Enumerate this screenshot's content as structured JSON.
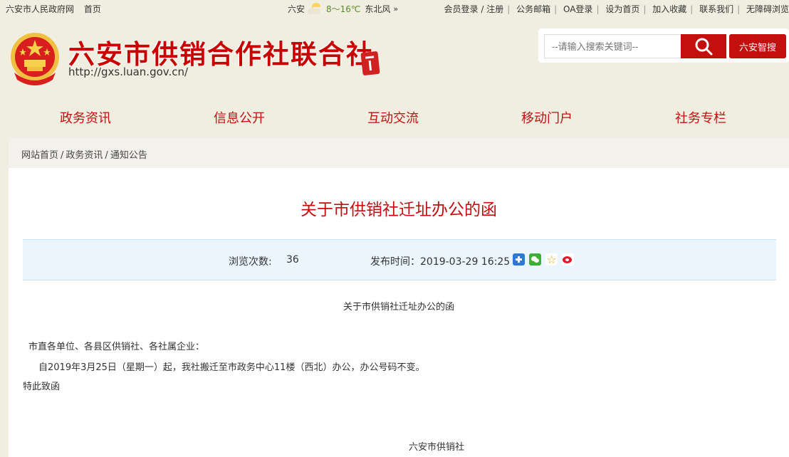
{
  "topbar": {
    "gov_link": "六安市人民政府网",
    "home_link": "首页",
    "city": "六安",
    "temp": "8～16℃",
    "wind": "东北风",
    "more": "»",
    "links": [
      "会员登录 / 注册",
      "公务邮箱",
      "OA登录",
      "设为首页",
      "加入收藏",
      "联系我们",
      "无障碍浏览"
    ]
  },
  "header": {
    "title": "六安市供销合作社联合社",
    "url": "http://gxs.luan.gov.cn/"
  },
  "search": {
    "placeholder": "--请输入搜索关键词--",
    "smart_label": "六安智搜"
  },
  "nav": {
    "items": [
      "政务资讯",
      "信息公开",
      "互动交流",
      "移动门户",
      "社务专栏"
    ]
  },
  "breadcrumb": {
    "items": [
      "网站首页",
      "政务资讯",
      "通知公告"
    ],
    "separator": "/"
  },
  "article": {
    "title": "关于市供销社迁址办公的函",
    "views_label": "浏览次数:",
    "views": "36",
    "date_label": "发布时间：2019-03-29 16:25",
    "heading": "关于市供销社迁址办公的函",
    "salutation": "市直各单位、各县区供销社、各社属企业：",
    "body": "自2019年3月25日（星期一）起，我社搬迁至市政务中心11楼（西北）办公，办公号码不变。",
    "closing": "特此致函",
    "signature": "六安市供销社"
  },
  "colors": {
    "brand_red": "#c40f0f",
    "page_bg": "#efeee0",
    "meta_bg": "#ebf5fd"
  }
}
